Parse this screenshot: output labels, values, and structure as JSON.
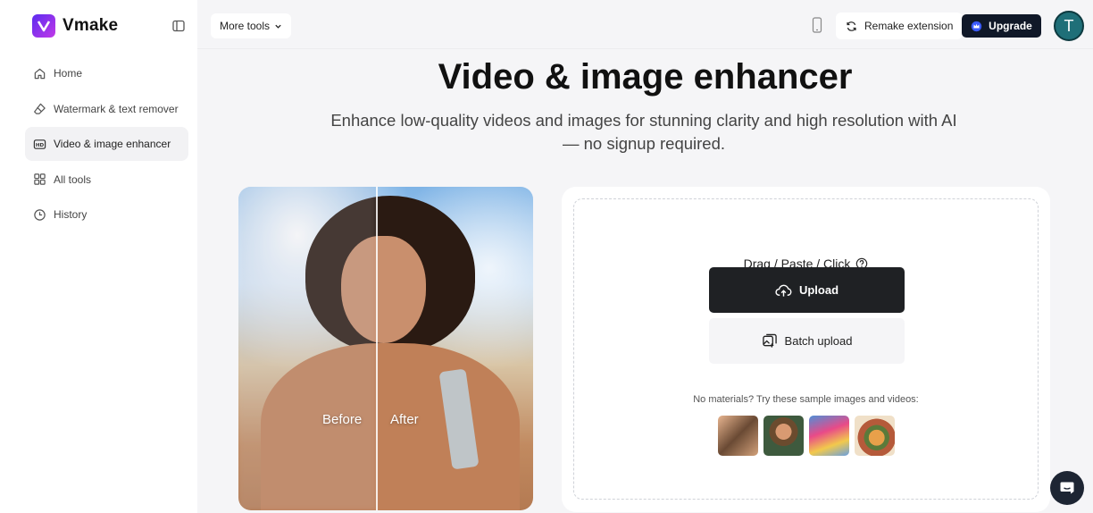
{
  "brand": {
    "name": "Vmake"
  },
  "sidebar": {
    "items": [
      {
        "label": "Home",
        "icon": "home-icon"
      },
      {
        "label": "Watermark & text remover",
        "icon": "eraser-icon"
      },
      {
        "label": "Video & image enhancer",
        "icon": "hd-icon",
        "active": true
      },
      {
        "label": "All tools",
        "icon": "grid-icon"
      },
      {
        "label": "History",
        "icon": "clock-icon"
      }
    ]
  },
  "topbar": {
    "more_tools": "More tools",
    "remake_extension": "Remake extension",
    "upgrade": "Upgrade",
    "avatar_initial": "T"
  },
  "hero": {
    "title": "Video & image enhancer",
    "subtitle": "Enhance low-quality videos and images for stunning clarity and high resolution with AI — no signup required."
  },
  "preview": {
    "before": "Before",
    "after": "After"
  },
  "upload": {
    "hint": "Drag / Paste / Click",
    "upload_label": "Upload",
    "batch_label": "Batch upload",
    "samples_hint": "No materials? Try these sample images and videos:"
  },
  "colors": {
    "accent": "#101828",
    "brand_gradient_start": "#5b2cf0",
    "brand_gradient_end": "#c239e8"
  }
}
